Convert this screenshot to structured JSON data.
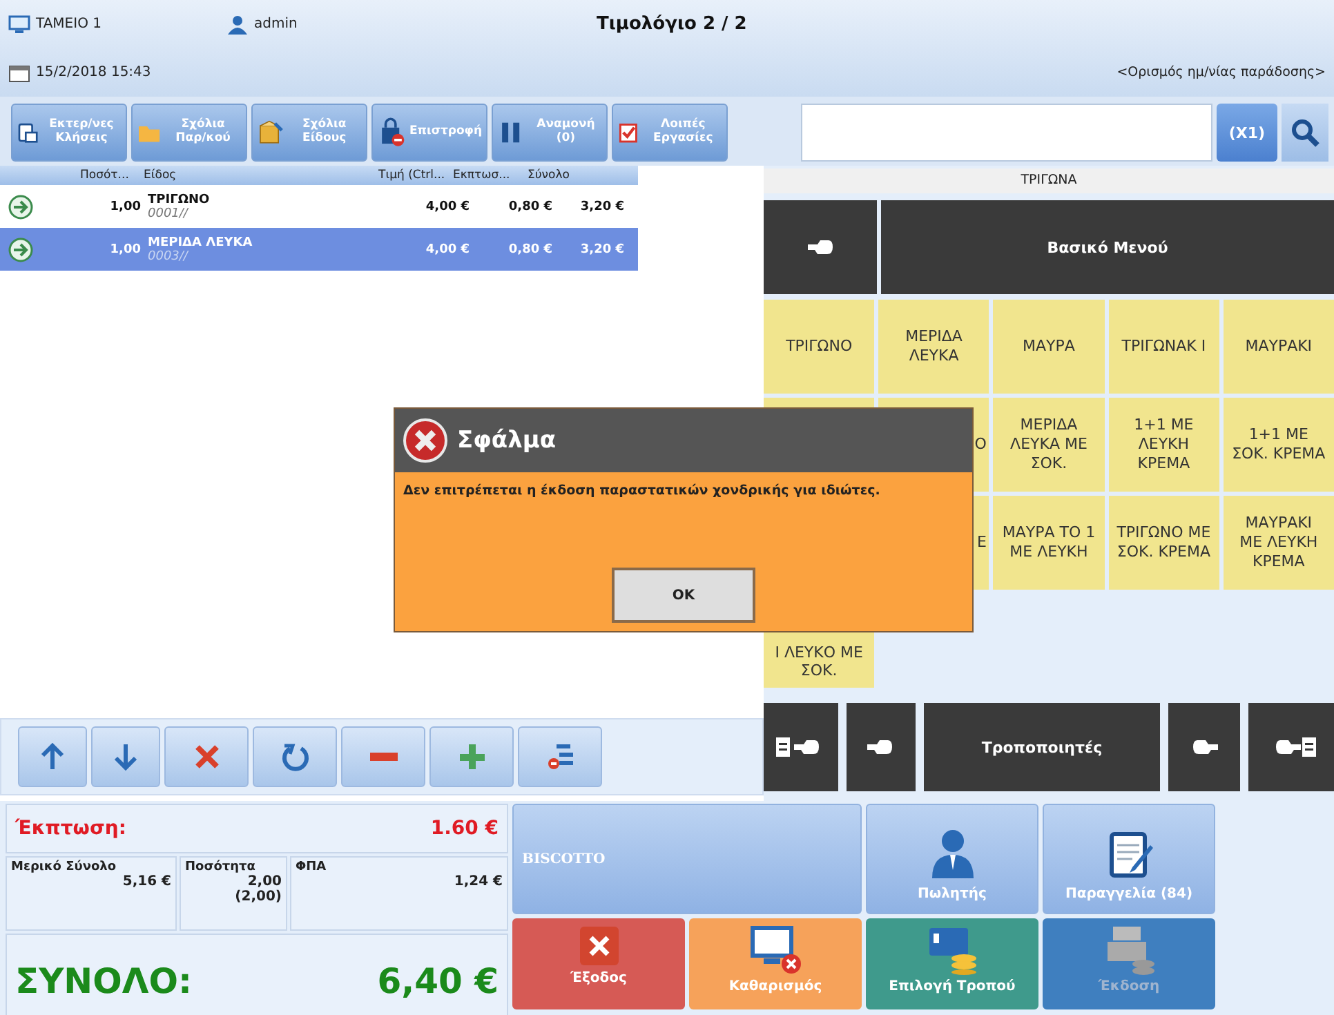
{
  "header": {
    "register": "TAMEIO 1",
    "user": "admin",
    "title": "Τιμολόγιο  2 / 2",
    "datetime": "15/2/2018 15:43",
    "delivery_link": "<Ορισμός ημ/νίας παράδοσης>"
  },
  "toolbar": [
    {
      "label": "Εκτερ/νες Κλήσεις",
      "kind": "calls"
    },
    {
      "label": "Σχόλια Παρ/κού",
      "kind": "folder"
    },
    {
      "label": "Σχόλια Είδους",
      "kind": "box"
    },
    {
      "label": "Επιστροφή",
      "kind": "return"
    },
    {
      "label": "Αναμονή (0)",
      "kind": "pause"
    },
    {
      "label": "Λοιπές Εργασίες",
      "kind": "tasks"
    }
  ],
  "search": {
    "multiplier": "(X1)"
  },
  "table": {
    "columns": [
      "Ποσότ...",
      "Είδος",
      "Τιμή (Ctrl...",
      "Εκπτωσ...",
      "Σύνολο"
    ],
    "rows": [
      {
        "qty": "1,00",
        "name": "ΤΡΙΓΩΝΟ",
        "code": "0001//",
        "price": "4,00 €",
        "discount": "0,80 €",
        "total": "3,20 €",
        "selected": false
      },
      {
        "qty": "1,00",
        "name": "ΜΕΡΙΔΑ ΛΕΥΚΑ",
        "code": "0003//",
        "price": "4,00 €",
        "discount": "0,80 €",
        "total": "3,20 €",
        "selected": true
      }
    ]
  },
  "line_controls": [
    {
      "kind": "up"
    },
    {
      "kind": "down"
    },
    {
      "kind": "delete"
    },
    {
      "kind": "undo"
    },
    {
      "kind": "minus"
    },
    {
      "kind": "plus"
    },
    {
      "kind": "options"
    }
  ],
  "category": {
    "title": "ΤΡΙΓΩΝΑ",
    "menu_title": "Βασικό Μενού",
    "items": [
      {
        "kind": "item",
        "label": "ΤΡΙΓΩΝΟ"
      },
      {
        "kind": "item",
        "label": "ΜΕΡΙΔΑ ΛΕΥΚΑ"
      },
      {
        "kind": "item",
        "label": "ΜΑΥΡΑ"
      },
      {
        "kind": "item",
        "label": "ΤΡΙΓΩΝΑΚ Ι"
      },
      {
        "kind": "item",
        "label": "ΜΑΥΡΑΚΙ"
      },
      {
        "kind": "covered"
      },
      {
        "kind": "fragment",
        "label": "Ο"
      },
      {
        "kind": "item",
        "label": "ΜΕΡΙΔΑ ΛΕΥΚΑ ΜΕ ΣΟΚ."
      },
      {
        "kind": "item",
        "label": "1+1  ΜΕ ΛΕΥΚΗ ΚΡΕΜΑ"
      },
      {
        "kind": "item",
        "label": "1+1 ΜΕ ΣΟΚ. ΚΡΕΜΑ"
      },
      {
        "kind": "covered"
      },
      {
        "kind": "fragment",
        "label": "Ε"
      },
      {
        "kind": "item",
        "label": "ΜΑΥΡΑ ΤΟ 1 ΜΕ ΛΕΥΚΗ"
      },
      {
        "kind": "item",
        "label": "ΤΡΙΓΩΝΟ ΜΕ ΣΟΚ. ΚΡΕΜΑ"
      },
      {
        "kind": "item",
        "label": "ΜΑΥΡΑΚΙ ΜΕ ΛΕΥΚΗ ΚΡΕΜΑ"
      },
      {
        "kind": "lower",
        "label": "Ι ΛΕΥΚΟ ΜΕ ΣΟΚ."
      }
    ],
    "modifiers_label": "Τροποποιητές"
  },
  "summary": {
    "discount_label": "Έκπτωση:",
    "discount": "1.60 €",
    "subtotal_label": "Μερικό Σύνολο",
    "subtotal": "5,16 €",
    "quantity_label": "Ποσότητα",
    "quantity": "2,00",
    "quantity_extra": "(2,00)",
    "vat_label": "ΦΠΑ",
    "vat": "1,24 €",
    "total_label": "ΣΥΝΟΛΟ:",
    "total": "6,40 €"
  },
  "actions": [
    {
      "kind": "customer",
      "label": "BISCOTTO",
      "disabled": false
    },
    {
      "kind": "seller",
      "label": "Πωλητής",
      "disabled": false
    },
    {
      "kind": "order",
      "label": "Παραγγελία (84)",
      "disabled": false
    },
    {
      "kind": "exit",
      "label": "Έξοδος",
      "disabled": false
    },
    {
      "kind": "clear",
      "label": "Καθαρισμός",
      "disabled": false
    },
    {
      "kind": "payment",
      "label": "Επιλογή Τροπού",
      "disabled": false
    },
    {
      "kind": "issue",
      "label": "Έκδοση",
      "disabled": true
    }
  ],
  "dialog": {
    "title": "Σφάλμα",
    "message": "Δεν επιτρέπεται η έκδοση παραστατικών χονδρικής για ιδιώτες.",
    "button": "OK"
  }
}
